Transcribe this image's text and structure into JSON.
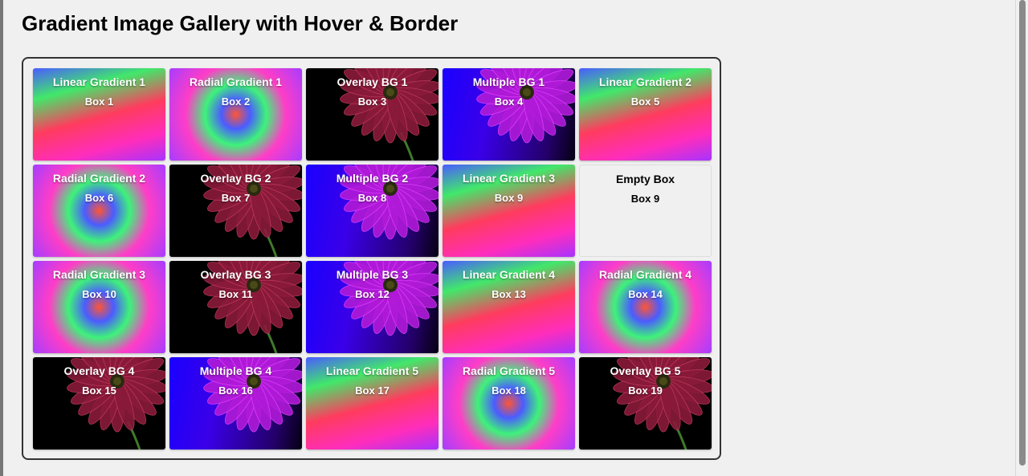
{
  "page": {
    "title": "Gradient Image Gallery with Hover & Border"
  },
  "gallery": {
    "boxes": [
      {
        "title": "Linear Gradient 1",
        "label": "Box 1",
        "style": "linear"
      },
      {
        "title": "Radial Gradient 1",
        "label": "Box 2",
        "style": "radial"
      },
      {
        "title": "Overlay BG 1",
        "label": "Box 3",
        "style": "overlay"
      },
      {
        "title": "Multiple BG 1",
        "label": "Box 4",
        "style": "multiple"
      },
      {
        "title": "Linear Gradient 2",
        "label": "Box 5",
        "style": "linear"
      },
      {
        "title": "Radial Gradient 2",
        "label": "Box 6",
        "style": "radial"
      },
      {
        "title": "Overlay BG 2",
        "label": "Box 7",
        "style": "overlay"
      },
      {
        "title": "Multiple BG 2",
        "label": "Box 8",
        "style": "multiple"
      },
      {
        "title": "Linear Gradient 3",
        "label": "Box 9",
        "style": "linear"
      },
      {
        "title": "Empty Box",
        "label": "Box 9",
        "style": "empty"
      },
      {
        "title": "Radial Gradient 3",
        "label": "Box 10",
        "style": "radial"
      },
      {
        "title": "Overlay BG 3",
        "label": "Box 11",
        "style": "overlay"
      },
      {
        "title": "Multiple BG 3",
        "label": "Box 12",
        "style": "multiple"
      },
      {
        "title": "Linear Gradient 4",
        "label": "Box 13",
        "style": "linear"
      },
      {
        "title": "Radial Gradient 4",
        "label": "Box 14",
        "style": "radial"
      },
      {
        "title": "Overlay BG 4",
        "label": "Box 15",
        "style": "overlay"
      },
      {
        "title": "Multiple BG 4",
        "label": "Box 16",
        "style": "multiple"
      },
      {
        "title": "Linear Gradient 5",
        "label": "Box 17",
        "style": "linear"
      },
      {
        "title": "Radial Gradient 5",
        "label": "Box 18",
        "style": "radial"
      },
      {
        "title": "Overlay BG 5",
        "label": "Box 19",
        "style": "overlay"
      }
    ]
  }
}
